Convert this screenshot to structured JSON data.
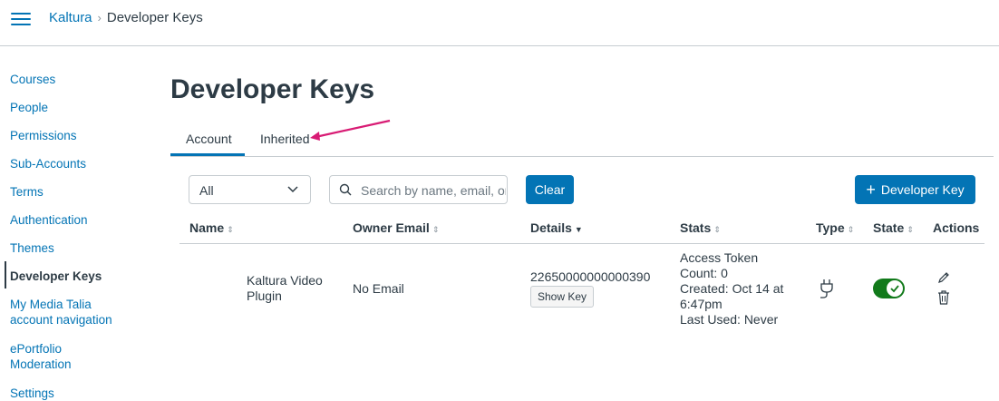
{
  "breadcrumb": {
    "root": "Kaltura",
    "separator": ">",
    "current": "Developer Keys"
  },
  "sidebar": {
    "items": [
      {
        "label": "Courses"
      },
      {
        "label": "People"
      },
      {
        "label": "Permissions"
      },
      {
        "label": "Sub-Accounts"
      },
      {
        "label": "Terms"
      },
      {
        "label": "Authentication"
      },
      {
        "label": "Themes"
      },
      {
        "label": "Developer Keys",
        "active": true
      },
      {
        "label": "My Media Talia account navigation"
      },
      {
        "label": "ePortfolio Moderation"
      },
      {
        "label": "Settings"
      }
    ]
  },
  "page": {
    "title": "Developer Keys"
  },
  "tabs": [
    {
      "label": "Account",
      "selected": true
    },
    {
      "label": "Inherited",
      "selected": false
    }
  ],
  "toolbar": {
    "filter_value": "All",
    "search_placeholder": "Search by name, email, or ID",
    "clear_label": "Clear",
    "add_key_label": "Developer Key"
  },
  "table": {
    "columns": [
      "Name",
      "Owner Email",
      "Details",
      "Stats",
      "Type",
      "State",
      "Actions"
    ],
    "rows": [
      {
        "name": "Kaltura Video Plugin",
        "owner_email": "No Email",
        "details_id": "22650000000000390",
        "show_key_label": "Show Key",
        "stats": [
          "Access Token Count: 0",
          "Created: Oct 14 at 6:47pm",
          "Last Used: Never"
        ],
        "type_icon": "plug-icon",
        "state_on": true
      }
    ]
  },
  "colors": {
    "link": "#0374b5",
    "text": "#2d3b45",
    "toggle_on": "#127a1b",
    "annotation_arrow": "#d81b74"
  }
}
